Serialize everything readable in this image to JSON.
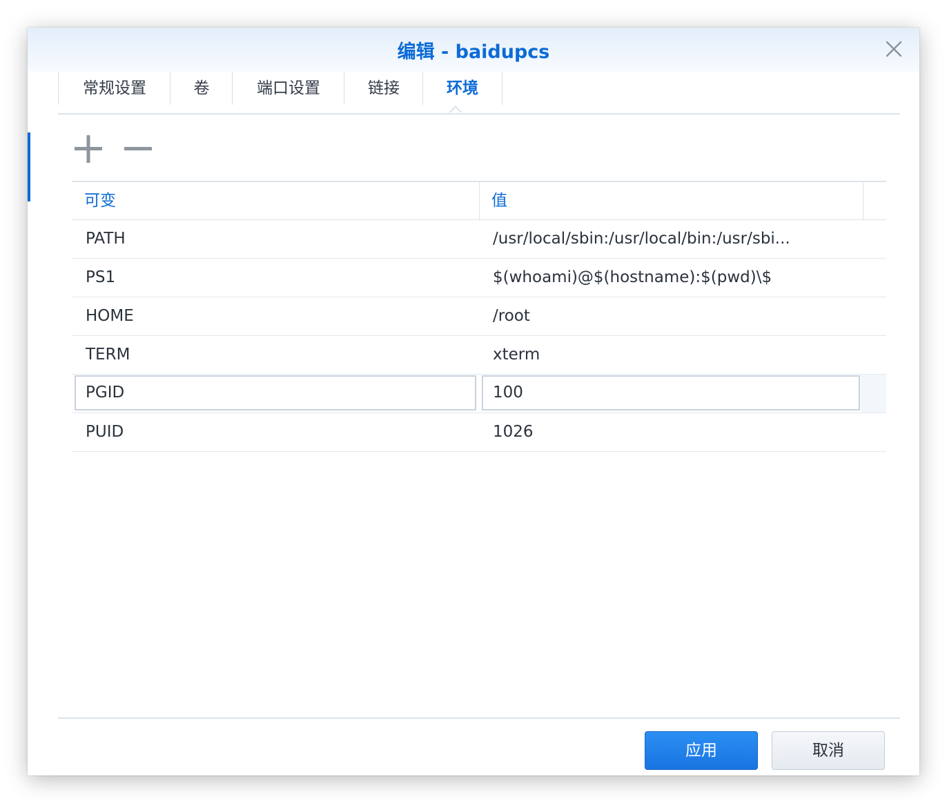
{
  "dialog": {
    "title": "编辑 - baidupcs",
    "close_icon": "close-icon"
  },
  "tabs": [
    {
      "label": "常规设置",
      "active": false
    },
    {
      "label": "卷",
      "active": false
    },
    {
      "label": "端口设置",
      "active": false
    },
    {
      "label": "链接",
      "active": false
    },
    {
      "label": "环境",
      "active": true
    }
  ],
  "toolbar": {
    "add_icon": "plus-icon",
    "remove_icon": "minus-icon"
  },
  "table": {
    "columns": [
      "可变",
      "值"
    ],
    "rows": [
      {
        "variable": "PATH",
        "value": "/usr/local/sbin:/usr/local/bin:/usr/sbi..."
      },
      {
        "variable": "PS1",
        "value": "$(whoami)@$(hostname):$(pwd)\\$"
      },
      {
        "variable": "HOME",
        "value": "/root"
      },
      {
        "variable": "TERM",
        "value": "xterm"
      },
      {
        "variable": "PGID",
        "value": "100",
        "editing": true
      },
      {
        "variable": "PUID",
        "value": "1026"
      }
    ]
  },
  "footer": {
    "apply_label": "应用",
    "cancel_label": "取消"
  },
  "colors": {
    "accent": "#0c6bd6",
    "primary_button": "#1a74e1"
  }
}
